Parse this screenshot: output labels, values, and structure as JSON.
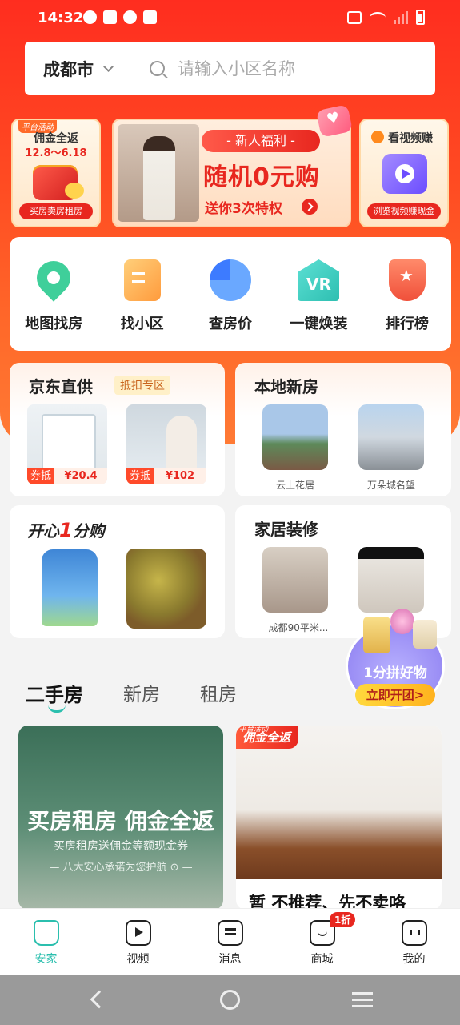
{
  "status_bar": {
    "time": "14:32"
  },
  "search": {
    "city": "成都市",
    "placeholder": "请输入小区名称"
  },
  "promos": {
    "left": {
      "tag": "平台活动",
      "title": "佣金全返",
      "date": "12.8～6.18",
      "button": "买房卖房租房"
    },
    "middle": {
      "badge": "- 新人福利 -",
      "title": "随机0元购",
      "subtitle": "送你3次特权"
    },
    "right": {
      "title": "看视频赚",
      "button": "浏览视频赚现金"
    }
  },
  "quick_nav": [
    {
      "label": "地图找房",
      "icon": "map-pin-icon"
    },
    {
      "label": "找小区",
      "icon": "community-icon"
    },
    {
      "label": "查房价",
      "icon": "pie-chart-icon"
    },
    {
      "label": "一键焕装",
      "icon": "vr-house-icon",
      "icon_text": "VR"
    },
    {
      "label": "排行榜",
      "icon": "trophy-icon"
    }
  ],
  "jd_card": {
    "title": "京东直供",
    "badge": "抵扣专区",
    "products": [
      {
        "tag": "券抵",
        "price": "¥20.4"
      },
      {
        "tag": "券抵",
        "price": "¥102"
      }
    ]
  },
  "new_house_card": {
    "title": "本地新房",
    "items": [
      {
        "label": "云上花居"
      },
      {
        "label": "万朵城名望"
      }
    ]
  },
  "happy_card": {
    "title_prefix": "开心",
    "title_num": "1",
    "title_suffix": "分购"
  },
  "deco_card": {
    "title": "家居装修",
    "items": [
      {
        "label": "成都90平米..."
      }
    ]
  },
  "group_buy": {
    "title": "1分拼好物",
    "button": "立即开团>"
  },
  "tabs": [
    {
      "label": "二手房"
    },
    {
      "label": "新房"
    },
    {
      "label": "租房"
    }
  ],
  "feed": {
    "left": {
      "title": "买房租房 佣金全返",
      "subtitle": "买房租房送佣金等额现金券",
      "note": "— 八大安心承诺为您护航 ⊙ —"
    },
    "right": {
      "badge_small": "平台活动",
      "badge": "佣金全返",
      "title": "暂 不推荐、先不卖咯"
    }
  },
  "bottom_nav": [
    {
      "label": "安家",
      "active": true
    },
    {
      "label": "视频"
    },
    {
      "label": "消息"
    },
    {
      "label": "商城",
      "badge": "1折"
    },
    {
      "label": "我的"
    }
  ],
  "colors": {
    "brand_red": "#e8271f",
    "accent_teal": "#2bbfae",
    "hero_orange": "#ff4a22"
  }
}
